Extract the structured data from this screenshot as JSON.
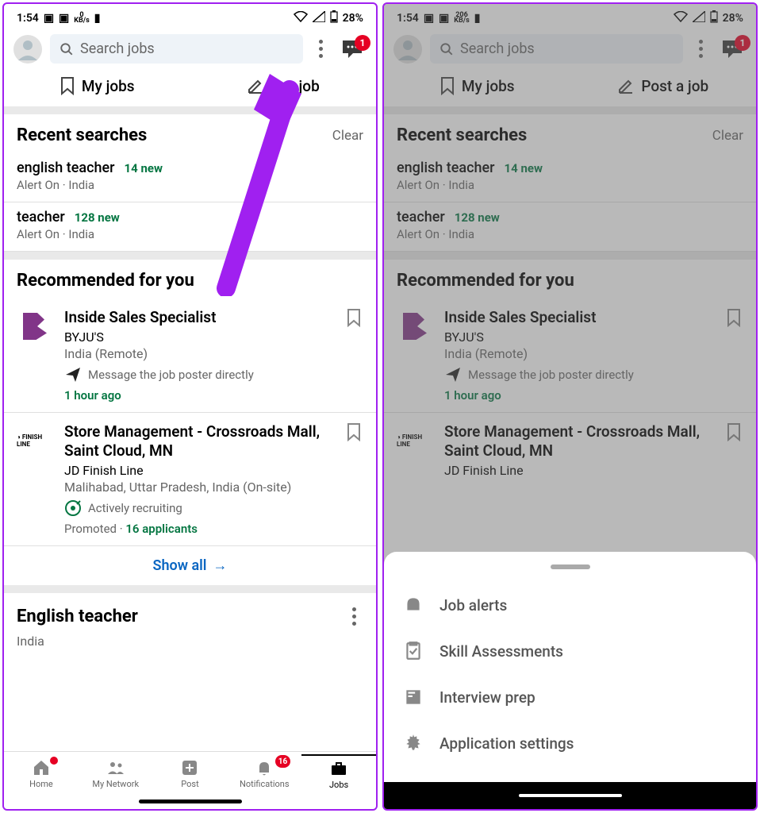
{
  "left": {
    "status": {
      "time": "1:54",
      "kbs": "0",
      "kbs_unit": "KB/s",
      "battery": "28%"
    },
    "search": {
      "placeholder": "Search jobs"
    },
    "chat_badge": "1",
    "tabs": {
      "my_jobs": "My jobs",
      "post_job": "Post a job_partial",
      "post_job_suffix": "st a job"
    },
    "recent": {
      "title": "Recent searches",
      "clear": "Clear",
      "items": [
        {
          "q": "english teacher",
          "new": "14 new",
          "meta": "Alert On · India"
        },
        {
          "q": "teacher",
          "new": "128 new",
          "meta": "Alert On · India"
        }
      ]
    },
    "rec": {
      "title": "Recommended for you",
      "jobs": [
        {
          "title": "Inside Sales Specialist",
          "company": "BYJU'S",
          "loc": "India (Remote)",
          "extra": "Message the job poster directly",
          "time": "1 hour ago"
        },
        {
          "title": "Store Management - Crossroads Mall, Saint Cloud, MN",
          "company": "JD Finish Line",
          "loc": "Malihabad, Uttar Pradesh, India (On-site)",
          "recruiting": "Actively recruiting",
          "promoted": "Promoted · ",
          "applicants": "16 applicants"
        }
      ],
      "show_all": "Show all"
    },
    "eng": {
      "title": "English teacher",
      "sub": "India"
    },
    "nav": {
      "home": "Home",
      "network": "My Network",
      "post": "Post",
      "notif": "Notifications",
      "jobs": "Jobs",
      "notif_badge": "16"
    }
  },
  "right": {
    "status": {
      "time": "1:54",
      "kbs": "206",
      "kbs_unit": "KB/s",
      "battery": "28%"
    },
    "search": {
      "placeholder": "Search jobs"
    },
    "chat_badge": "1",
    "tabs": {
      "my_jobs": "My jobs",
      "post_job": "Post a job"
    },
    "recent": {
      "title": "Recent searches",
      "clear": "Clear",
      "items": [
        {
          "q": "english teacher",
          "new": "14 new",
          "meta": "Alert On · India"
        },
        {
          "q": "teacher",
          "new": "128 new",
          "meta": "Alert On · India"
        }
      ]
    },
    "rec": {
      "title": "Recommended for you",
      "jobs": [
        {
          "title": "Inside Sales Specialist",
          "company": "BYJU'S",
          "loc": "India (Remote)",
          "extra": "Message the job poster directly",
          "time": "1 hour ago"
        },
        {
          "title": "Store Management - Crossroads Mall, Saint Cloud, MN",
          "company": "JD Finish Line"
        }
      ]
    },
    "sheet": {
      "items": [
        "Job alerts",
        "Skill Assessments",
        "Interview prep",
        "Application settings"
      ]
    }
  }
}
